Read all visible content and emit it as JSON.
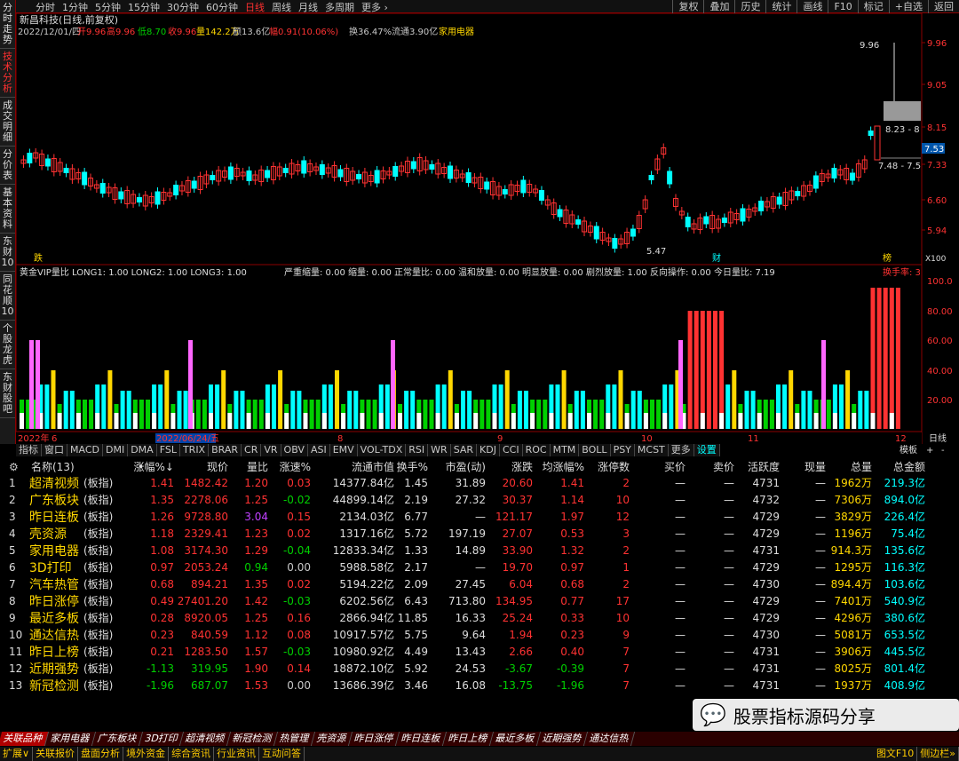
{
  "leftbar": [
    "分时走势",
    "技术分析",
    "成交明细",
    "分价表",
    "基本资料",
    "东财10",
    "同花顺10",
    "个股龙虎",
    "东财股吧"
  ],
  "topbar": {
    "items": [
      "分时",
      "1分钟",
      "5分钟",
      "15分钟",
      "30分钟",
      "60分钟",
      "日线",
      "周线",
      "月线",
      "多周期",
      "更多 ›"
    ],
    "right": [
      "复权",
      "叠加",
      "历史",
      "统计",
      "画线",
      "F10",
      "标记",
      "+自选",
      "返回"
    ]
  },
  "stock": {
    "title": "新昌科技(日线,前复权)",
    "date": "2022/12/01/四",
    "open": "开9.96",
    "high": "高9.96",
    "low": "低8.70",
    "close": "收9.96",
    "vol": "量142.2万",
    "amount": "额13.6亿",
    "change": "幅0.91(10.06%)",
    "turnover": "换36.47%",
    "float": "流通3.90亿",
    "sector": "家用电器"
  },
  "price_axis": [
    "9.96",
    "9.05",
    "8.15",
    "7.33",
    "6.60",
    "5.94"
  ],
  "price_labels": {
    "high": "9.96",
    "low": "5.47",
    "current": "7.53",
    "band1": "8.23 - 8",
    "band2": "7.48 - 7.5",
    "x100": "X100",
    "die": "跌",
    "cai": "财",
    "bang": "榜"
  },
  "indicator": {
    "title": "黄金VIP量比 LONG1: 1.00  LONG2: 1.00  LONG3: 1.00",
    "stats": "严重缩量: 0.00  缩量: 0.00  正常量比: 0.00  温和放量: 0.00  明显放量: 0.00  剧烈放量: 1.00  反向操作: 0.00  今日量比: 7.19",
    "right_label": "换手率: 3",
    "axis": [
      "100.0",
      "80.00",
      "60.00",
      "40.00",
      "20.00"
    ]
  },
  "ind_tabs": [
    "指标",
    "窗口",
    "MACD",
    "DMI",
    "DMA",
    "FSL",
    "TRIX",
    "BRAR",
    "CR",
    "VR",
    "OBV",
    "ASI",
    "EMV",
    "VOL-TDX",
    "RSI",
    "WR",
    "SAR",
    "KDJ",
    "CCI",
    "ROC",
    "MTM",
    "BOLL",
    "PSY",
    "MCST",
    "更多",
    "设置"
  ],
  "timeline": [
    "2022年",
    "6",
    "2022/06/24/五",
    "8",
    "9",
    "10",
    "11",
    "12",
    "日线"
  ],
  "time_tabs_right": [
    "模板",
    "+",
    "-"
  ],
  "table": {
    "headers": [
      "名称(13)",
      "•",
      "涨幅%↓",
      "现价",
      "量比",
      "涨速%",
      "流通市值",
      "换手%",
      "市盈(动)",
      "涨跌",
      "均涨幅%",
      "涨停数",
      "买价",
      "卖价",
      "活跃度",
      "现量",
      "总量",
      "总金额"
    ],
    "rows": [
      [
        "1",
        "超清视频",
        "(板指)",
        "1.41",
        "1482.42",
        "1.20",
        "0.03",
        "14377.84亿",
        "1.45",
        "31.89",
        "20.60",
        "1.41",
        "2",
        "—",
        "—",
        "4731",
        "—",
        "1962万",
        "219.3亿"
      ],
      [
        "2",
        "广东板块",
        "(板指)",
        "1.35",
        "2278.06",
        "1.25",
        "-0.02",
        "44899.14亿",
        "2.19",
        "27.32",
        "30.37",
        "1.14",
        "10",
        "—",
        "—",
        "4732",
        "—",
        "7306万",
        "894.0亿"
      ],
      [
        "3",
        "昨日连板",
        "(板指)",
        "1.26",
        "9728.80",
        "3.04",
        "0.15",
        "2134.03亿",
        "6.77",
        "—",
        "121.17",
        "1.97",
        "12",
        "—",
        "—",
        "4729",
        "—",
        "3829万",
        "226.4亿"
      ],
      [
        "4",
        "壳资源",
        "(板指)",
        "1.18",
        "2329.41",
        "1.23",
        "0.02",
        "1317.16亿",
        "5.72",
        "197.19",
        "27.07",
        "0.53",
        "3",
        "—",
        "—",
        "4729",
        "—",
        "1196万",
        "75.4亿"
      ],
      [
        "5",
        "家用电器",
        "(板指)",
        "1.08",
        "3174.30",
        "1.29",
        "-0.04",
        "12833.34亿",
        "1.33",
        "14.89",
        "33.90",
        "1.32",
        "2",
        "—",
        "—",
        "4731",
        "—",
        "914.3万",
        "135.6亿"
      ],
      [
        "6",
        "3D打印",
        "(板指)",
        "0.97",
        "2053.24",
        "0.94",
        "0.00",
        "5988.58亿",
        "2.17",
        "—",
        "19.70",
        "0.97",
        "1",
        "—",
        "—",
        "4729",
        "—",
        "1295万",
        "116.3亿"
      ],
      [
        "7",
        "汽车热管",
        "(板指)",
        "0.68",
        "894.21",
        "1.35",
        "0.02",
        "5194.22亿",
        "2.09",
        "27.45",
        "6.04",
        "0.68",
        "2",
        "—",
        "—",
        "4730",
        "—",
        "894.4万",
        "103.6亿"
      ],
      [
        "8",
        "昨日涨停",
        "(板指)",
        "0.49",
        "27401.20",
        "1.42",
        "-0.03",
        "6202.56亿",
        "6.43",
        "713.80",
        "134.95",
        "0.77",
        "17",
        "—",
        "—",
        "4729",
        "—",
        "7401万",
        "540.9亿"
      ],
      [
        "9",
        "最近多板",
        "(板指)",
        "0.28",
        "8920.05",
        "1.25",
        "0.16",
        "2866.94亿",
        "11.85",
        "16.33",
        "25.24",
        "0.33",
        "10",
        "—",
        "—",
        "4729",
        "—",
        "4296万",
        "380.6亿"
      ],
      [
        "10",
        "通达信热",
        "(板指)",
        "0.23",
        "840.59",
        "1.12",
        "0.08",
        "10917.57亿",
        "5.75",
        "9.64",
        "1.94",
        "0.23",
        "9",
        "—",
        "—",
        "4730",
        "—",
        "5081万",
        "653.5亿"
      ],
      [
        "11",
        "昨日上榜",
        "(板指)",
        "0.21",
        "1283.50",
        "1.57",
        "-0.03",
        "10980.92亿",
        "4.49",
        "13.43",
        "2.66",
        "0.40",
        "7",
        "—",
        "—",
        "4731",
        "—",
        "3906万",
        "445.5亿"
      ],
      [
        "12",
        "近期强势",
        "(板指)",
        "-1.13",
        "319.95",
        "1.90",
        "0.14",
        "18872.10亿",
        "5.92",
        "24.53",
        "-3.67",
        "-0.39",
        "7",
        "—",
        "—",
        "4731",
        "—",
        "8025万",
        "801.4亿"
      ],
      [
        "13",
        "新冠检测",
        "(板指)",
        "-1.96",
        "687.07",
        "1.53",
        "0.00",
        "13686.39亿",
        "3.46",
        "16.08",
        "-13.75",
        "-1.96",
        "7",
        "—",
        "—",
        "4731",
        "—",
        "1937万",
        "408.9亿"
      ]
    ]
  },
  "bottomtabs": [
    "关联品种",
    "家用电器",
    "广东板块",
    "3D打印",
    "超清视频",
    "新冠检测",
    "热管理",
    "壳资源",
    "昨日涨停",
    "昨日连板",
    "昨日上榜",
    "最近多板",
    "近期强势",
    "通达信热"
  ],
  "bottombar": [
    "扩展∨",
    "关联报价",
    "盘面分析",
    "境外资金",
    "综合资讯",
    "行业资讯",
    "互动问答"
  ],
  "bottom_right": [
    "图文F10",
    "侧边栏»"
  ],
  "watermark": "股票指标源码分享",
  "colors": {
    "up": "#ff3232",
    "down": "#00d000",
    "cyan": "#00ffff",
    "yellow": "#ffd700",
    "magenta": "#ff66ff",
    "white": "#ffffff"
  }
}
